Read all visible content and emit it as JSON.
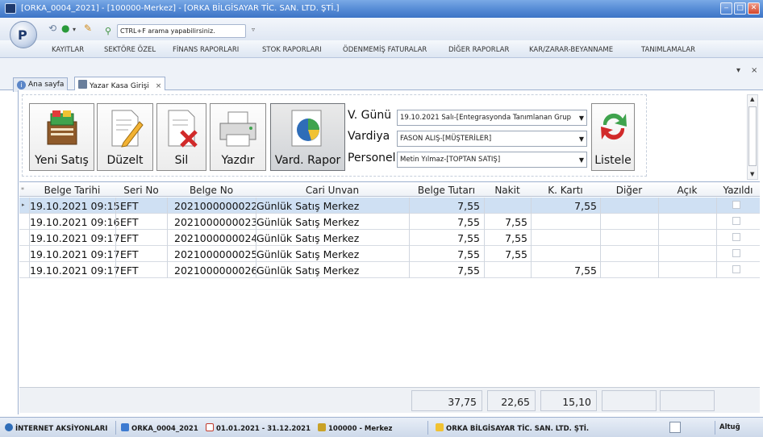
{
  "window": {
    "title": "[ORKA_0004_2021]  -  [100000-Merkez]  -  [ORKA BİLGİSAYAR TİC. SAN. LTD. ŞTİ.]"
  },
  "quickbar": {
    "search_placeholder": "CTRL+F arama yapabilirsiniz."
  },
  "menu": {
    "items": [
      "KAYITLAR",
      "SEKTÖRE ÖZEL",
      "FİNANS RAPORLARI",
      "STOK RAPORLARI",
      "ÖDENMEMİŞ FATURALAR",
      "DİĞER RAPORLAR",
      "KAR/ZARAR-BEYANNAME",
      "TANIMLAMALAR"
    ]
  },
  "tabs": [
    {
      "label": "Ana sayfa"
    },
    {
      "label": "Yazar Kasa Girişi",
      "close": "×"
    }
  ],
  "tab_controls": {
    "pin": "▾",
    "close": "×"
  },
  "toolbar": {
    "new_sale": "Yeni Satış",
    "edit": "Düzelt",
    "delete": "Sil",
    "print": "Yazdır",
    "shift_report": "Vard. Rapor",
    "list": "Listele"
  },
  "filters": {
    "day_label": "V. Günü",
    "day_value": "19.10.2021 Salı-[Entegrasyonda Tanımlanan Grup",
    "shift_label": "Vardiya",
    "shift_value": "FASON ALIŞ-[MÜŞTERİLER]",
    "staff_label": "Personel",
    "staff_value": "Metin Yılmaz-[TOPTAN SATIŞ]"
  },
  "grid": {
    "columns": [
      "Belge Tarihi",
      "Seri No",
      "Belge No",
      "Cari Unvan",
      "Belge Tutarı",
      "Nakit",
      "K. Kartı",
      "Diğer",
      "Açık",
      "Yazıldı"
    ],
    "rows": [
      {
        "date": "19.10.2021 09:15:",
        "serial": "EFT",
        "doc_no": "2021000000022",
        "account": "Günlük Satış Merkez",
        "amount": "7,55",
        "cash": "",
        "card": "7,55",
        "other": "",
        "open": "",
        "printed": false
      },
      {
        "date": "19.10.2021 09:16:",
        "serial": "EFT",
        "doc_no": "2021000000023",
        "account": "Günlük Satış Merkez",
        "amount": "7,55",
        "cash": "7,55",
        "card": "",
        "other": "",
        "open": "",
        "printed": false
      },
      {
        "date": "19.10.2021 09:17:",
        "serial": "EFT",
        "doc_no": "2021000000024",
        "account": "Günlük Satış Merkez",
        "amount": "7,55",
        "cash": "7,55",
        "card": "",
        "other": "",
        "open": "",
        "printed": false
      },
      {
        "date": "19.10.2021 09:17:",
        "serial": "EFT",
        "doc_no": "2021000000025",
        "account": "Günlük Satış Merkez",
        "amount": "7,55",
        "cash": "7,55",
        "card": "",
        "other": "",
        "open": "",
        "printed": false
      },
      {
        "date": "19.10.2021 09:17:",
        "serial": "EFT",
        "doc_no": "2021000000026",
        "account": "Günlük Satış Merkez",
        "amount": "7,55",
        "cash": "",
        "card": "7,55",
        "other": "",
        "open": "",
        "printed": false
      }
    ],
    "totals": {
      "amount": "37,75",
      "cash": "22,65",
      "card": "15,10",
      "other": "",
      "open": ""
    }
  },
  "statusbar": {
    "internet": "İNTERNET AKSİYONLARI",
    "database": "ORKA_0004_2021",
    "period": "01.01.2021 - 31.12.2021",
    "branch": "100000 - Merkez",
    "company": "ORKA BİLGİSAYAR TİC. SAN. LTD. ŞTİ.",
    "user": "Altuğ"
  }
}
